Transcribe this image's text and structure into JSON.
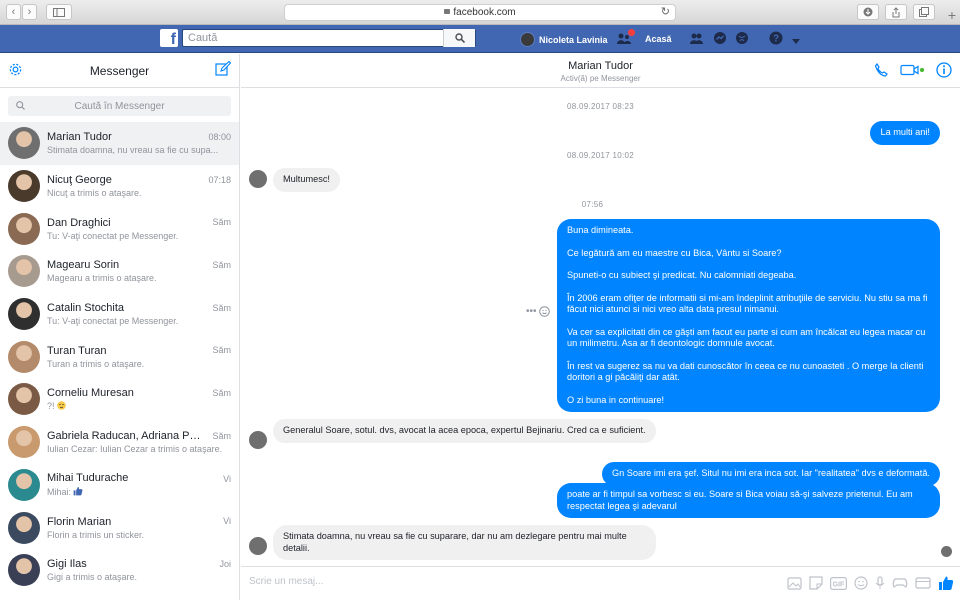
{
  "browser": {
    "url": "facebook.com"
  },
  "fb": {
    "search_placeholder": "Caută",
    "user_name": "Nicoleta Lavinia",
    "home_label": "Acasă"
  },
  "sidebar": {
    "title": "Messenger",
    "search_placeholder": "Caută în Messenger",
    "conversations": [
      {
        "name": "Marian Tudor",
        "snippet": "Stimata doamna, nu vreau sa fie cu supa...",
        "time": "08:00",
        "active": true,
        "color": "#6f6f6f"
      },
      {
        "name": "Nicuţ George",
        "snippet": "Nicuţ a trimis o ataşare.",
        "time": "07:18",
        "color": "#4a3a2c"
      },
      {
        "name": "Dan Draghici",
        "snippet": "Tu: V-aţi conectat pe Messenger.",
        "time": "Săm",
        "color": "#8a6a52"
      },
      {
        "name": "Magearu Sorin",
        "snippet": "Magearu a trimis o ataşare.",
        "time": "Săm",
        "color": "#a79a8e"
      },
      {
        "name": "Catalin Stochita",
        "snippet": "Tu: V-aţi conectat pe Messenger.",
        "time": "Săm",
        "color": "#2f2f2f"
      },
      {
        "name": "Turan Turan",
        "snippet": "Turan a trimis o ataşare.",
        "time": "Săm",
        "color": "#b38a6a"
      },
      {
        "name": "Corneliu Muresan",
        "snippet": "?! ",
        "time": "Săm",
        "color": "#7a5a44"
      },
      {
        "name": "Gabriela Raducan, Adriana Petrescu",
        "snippet": "Iulian Cezar: Iulian Cezar a trimis o ataşare.",
        "time": "Săm",
        "color": "#c99a6e"
      },
      {
        "name": "Mihai Tudurache",
        "snippet": "Mihai: ",
        "time": "Vi",
        "color": "#2a8a90"
      },
      {
        "name": "Florin Marian",
        "snippet": "Florin a trimis un sticker.",
        "time": "Vi",
        "color": "#3c4a60"
      },
      {
        "name": "Gigi Ilas",
        "snippet": "Gigi a trimis o ataşare.",
        "time": "Joi",
        "color": "#3a3f55"
      }
    ]
  },
  "chat": {
    "contact_name": "Marian Tudor",
    "status": "Activ(ă) pe Messenger",
    "timestamps": [
      "08.09.2017 08:23",
      "08.09.2017 10:02",
      "07:56"
    ],
    "messages": {
      "m1": "La multi ani!",
      "m2": "Multumesc!",
      "m3": [
        "Buna dimineata.",
        "Ce legătură am eu maestre cu Bica, Vântu si Soare?",
        "Spuneti-o cu subiect şi predicat. Nu calomniati degeaba.",
        "În 2006 eram ofiţer de informatii si mi-am îndeplinit atribuţiile de serviciu. Nu stiu sa ma fi făcut nici atunci si nici vreo alta data presul nimanui.",
        "Va cer sa explicitati din ce găşti am facut eu parte si cum am încălcat eu legea macar cu un milimetru. Asa ar fi deontologic domnule avocat.",
        "În rest va sugerez sa nu va dati cunoscător în ceea ce nu cunoasteti . O merge la clienti doritori a gi păcăliţi dar atât.",
        "O zi buna in continuare!"
      ],
      "m4": "Generalul Soare, sotul. dvs, avocat la acea epoca, expertul Bejinariu. Cred ca e suficient.",
      "m5": "Gn Soare imi era şef. Situl nu imi era inca sot. Iar \"realitatea\" dvs e deformată.",
      "m6": "poate ar fi timpul sa vorbesc si eu. Soare si Bica voiau să-şi salveze prietenul. Eu am respectat legea şi adevarul",
      "m7": "Stimata doamna, nu vreau sa fie cu suparare, dar nu am dezlegare pentru mai multe detalii."
    },
    "composer_placeholder": "Scrie un mesaj..."
  },
  "colors": {
    "fb_blue": "#4267b2",
    "messenger_blue": "#0084ff"
  }
}
